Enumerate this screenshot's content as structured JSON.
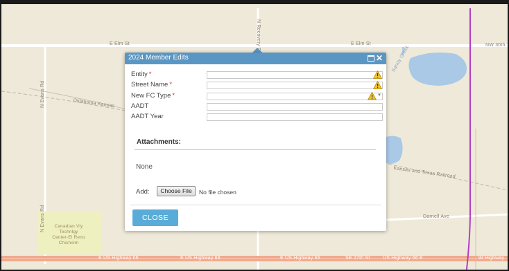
{
  "map": {
    "labels": {
      "e_elm_st_left": "E Elm St",
      "e_elm_st_right": "E Elm St",
      "nw_30th": "NW 30th",
      "n_evans_rd_top": "N Evans Rd",
      "n_evans_rd_bottom": "N Evans Rd",
      "n_recovery_rd": "N Recovery Rd",
      "oklahoma_kansas": "Oklahoma Kansas",
      "kansas_texas": "Kansas and Texas Railroad",
      "darnell_ave": "Darnell Ave",
      "creek": "Sandy Creek",
      "facility_line1": "Canadian Vly",
      "facility_line2": "Technlgy",
      "facility_line3": "Center-El Reno",
      "facility_line4": "Chisholm",
      "hwy_1": "E US Highway 66",
      "hwy_2": "E US Highway 66",
      "hwy_3": "E US Highway 66",
      "hwy_4": "SE 27th St",
      "hwy_5": "US Highway 66 E",
      "hwy_6": "W Highway"
    }
  },
  "popup": {
    "title": "2024 Member Edits",
    "fields": [
      {
        "label": "Entity",
        "required": "*",
        "value": ""
      },
      {
        "label": "Street Name",
        "required": "*",
        "value": ""
      },
      {
        "label": "New FC Type",
        "required": "*",
        "value": ""
      },
      {
        "label": "AADT",
        "required": "",
        "value": ""
      },
      {
        "label": "AADT Year",
        "required": "",
        "value": ""
      }
    ],
    "attachments_title": "Attachments:",
    "attachments_none": "None",
    "add_label": "Add:",
    "choose_file_label": "Choose File",
    "no_file_text": "No file chosen",
    "close_label": "CLOSE"
  },
  "colors": {
    "header": "#5a96c4",
    "close_button": "#5aacd8",
    "required": "#d9322b",
    "map_background": "#efe9d9",
    "water": "#a9c9e6",
    "highway": "#f1a98b",
    "boundary": "#b33ec2"
  }
}
